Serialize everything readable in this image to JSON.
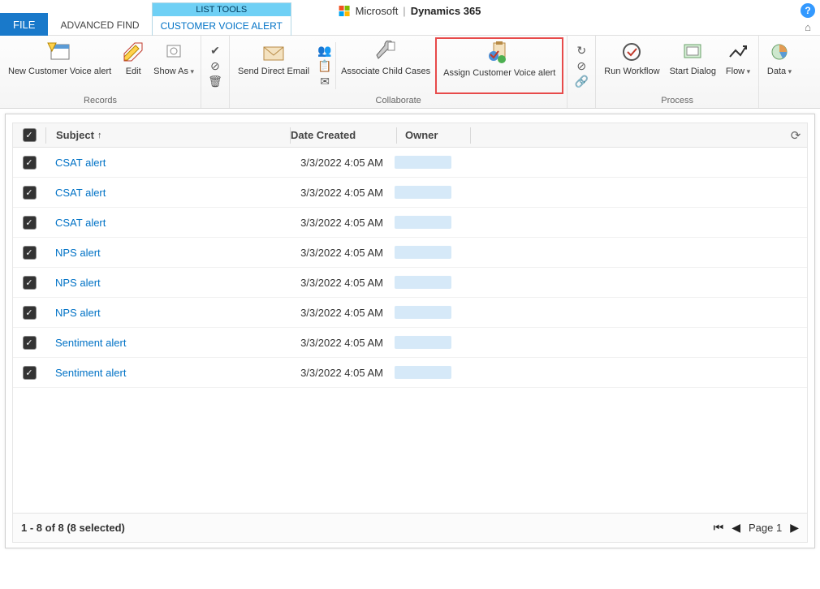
{
  "header": {
    "file_label": "FILE",
    "advanced_find_label": "ADVANCED FIND",
    "list_tools_label": "LIST TOOLS",
    "cva_tab_label": "CUSTOMER VOICE ALERT",
    "brand_ms": "Microsoft",
    "brand_product": "Dynamics 365"
  },
  "ribbon": {
    "records_label": "Records",
    "collaborate_label": "Collaborate",
    "process_label": "Process",
    "new_cva": "New Customer Voice alert",
    "edit": "Edit",
    "show_as": "Show As",
    "send_direct_email": "Send Direct Email",
    "associate_child_cases": "Associate Child Cases",
    "assign_cva": "Assign Customer Voice alert",
    "run_workflow": "Run Workflow",
    "start_dialog": "Start Dialog",
    "flow": "Flow",
    "data": "Data"
  },
  "grid": {
    "col_subject": "Subject",
    "col_date": "Date Created",
    "col_owner": "Owner",
    "rows": [
      {
        "subject": "CSAT alert",
        "date": "3/3/2022 4:05 AM"
      },
      {
        "subject": "CSAT alert",
        "date": "3/3/2022 4:05 AM"
      },
      {
        "subject": "CSAT alert",
        "date": "3/3/2022 4:05 AM"
      },
      {
        "subject": "NPS alert",
        "date": "3/3/2022 4:05 AM"
      },
      {
        "subject": "NPS alert",
        "date": "3/3/2022 4:05 AM"
      },
      {
        "subject": "NPS alert",
        "date": "3/3/2022 4:05 AM"
      },
      {
        "subject": "Sentiment alert",
        "date": "3/3/2022 4:05 AM"
      },
      {
        "subject": "Sentiment alert",
        "date": "3/3/2022 4:05 AM"
      }
    ]
  },
  "footer": {
    "status": "1 - 8 of 8 (8 selected)",
    "page_label": "Page 1"
  }
}
